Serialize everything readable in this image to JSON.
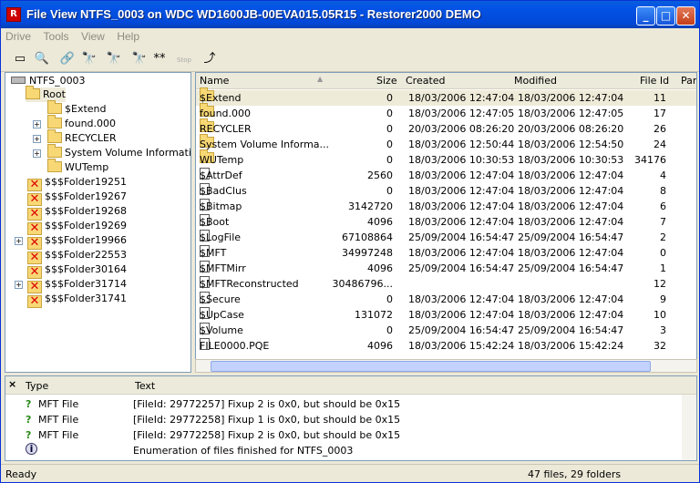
{
  "window": {
    "title": "File View NTFS_0003 on WDC WD1600JB-00EVA015.05R15 - Restorer2000 DEMO"
  },
  "menu": [
    "Drive",
    "Tools",
    "View",
    "Help"
  ],
  "toolbar": {
    "stop_label": "Stop"
  },
  "tree": {
    "root_drive": "NTFS_0003",
    "root": "Root",
    "root_children": [
      "$Extend",
      "found.000",
      "RECYCLER",
      "System Volume Information",
      "WUTemp"
    ],
    "lost_folders": [
      "$$$Folder19251",
      "$$$Folder19267",
      "$$$Folder19268",
      "$$$Folder19269",
      "$$$Folder19966",
      "$$$Folder22553",
      "$$$Folder30164",
      "$$$Folder31714",
      "$$$Folder31741"
    ]
  },
  "list": {
    "columns": [
      "Name",
      "Size",
      "Created",
      "Modified",
      "File Id",
      "Par"
    ],
    "rows": [
      {
        "name": "$Extend",
        "size": "0",
        "created": "18/03/2006 12:47:04",
        "modified": "18/03/2006 12:47:04",
        "id": "11",
        "kind": "folder"
      },
      {
        "name": "found.000",
        "size": "0",
        "created": "18/03/2006 12:47:05",
        "modified": "18/03/2006 12:47:05",
        "id": "17",
        "kind": "folder"
      },
      {
        "name": "RECYCLER",
        "size": "0",
        "created": "20/03/2006 08:26:20",
        "modified": "20/03/2006 08:26:20",
        "id": "26",
        "kind": "folder"
      },
      {
        "name": "System Volume Informa...",
        "size": "0",
        "created": "18/03/2006 12:50:44",
        "modified": "18/03/2006 12:54:50",
        "id": "24",
        "kind": "folder"
      },
      {
        "name": "WUTemp",
        "size": "0",
        "created": "18/03/2006 10:30:53",
        "modified": "18/03/2006 10:30:53",
        "id": "34176",
        "kind": "folder"
      },
      {
        "name": "$AttrDef",
        "size": "2560",
        "created": "18/03/2006 12:47:04",
        "modified": "18/03/2006 12:47:04",
        "id": "4",
        "kind": "file"
      },
      {
        "name": "$BadClus",
        "size": "0",
        "created": "18/03/2006 12:47:04",
        "modified": "18/03/2006 12:47:04",
        "id": "8",
        "kind": "file"
      },
      {
        "name": "$Bitmap",
        "size": "3142720",
        "created": "18/03/2006 12:47:04",
        "modified": "18/03/2006 12:47:04",
        "id": "6",
        "kind": "file"
      },
      {
        "name": "$Boot",
        "size": "4096",
        "created": "18/03/2006 12:47:04",
        "modified": "18/03/2006 12:47:04",
        "id": "7",
        "kind": "file"
      },
      {
        "name": "$LogFile",
        "size": "67108864",
        "created": "25/09/2004 16:54:47",
        "modified": "25/09/2004 16:54:47",
        "id": "2",
        "kind": "file"
      },
      {
        "name": "$MFT",
        "size": "34997248",
        "created": "18/03/2006 12:47:04",
        "modified": "18/03/2006 12:47:04",
        "id": "0",
        "kind": "file"
      },
      {
        "name": "$MFTMirr",
        "size": "4096",
        "created": "25/09/2004 16:54:47",
        "modified": "25/09/2004 16:54:47",
        "id": "1",
        "kind": "file"
      },
      {
        "name": "$MFTReconstructed",
        "size": "30486796...",
        "created": "",
        "modified": "",
        "id": "12",
        "kind": "file"
      },
      {
        "name": "$Secure",
        "size": "0",
        "created": "18/03/2006 12:47:04",
        "modified": "18/03/2006 12:47:04",
        "id": "9",
        "kind": "file"
      },
      {
        "name": "$UpCase",
        "size": "131072",
        "created": "18/03/2006 12:47:04",
        "modified": "18/03/2006 12:47:04",
        "id": "10",
        "kind": "file"
      },
      {
        "name": "$Volume",
        "size": "0",
        "created": "25/09/2004 16:54:47",
        "modified": "25/09/2004 16:54:47",
        "id": "3",
        "kind": "file"
      },
      {
        "name": "FILE0000.PQE",
        "size": "4096",
        "created": "18/03/2006 15:42:24",
        "modified": "18/03/2006 15:42:24",
        "id": "32",
        "kind": "file"
      }
    ]
  },
  "log": {
    "columns": [
      "Type",
      "Text"
    ],
    "rows": [
      {
        "type": "MFT File",
        "text": "[FileId: 29772257] Fixup 2 is 0x0, but should be 0x15",
        "icon": "question-icon"
      },
      {
        "type": "MFT File",
        "text": "[FileId: 29772258] Fixup 1 is 0x0, but should be 0x15",
        "icon": "question-icon"
      },
      {
        "type": "MFT File",
        "text": "[FileId: 29772258] Fixup 2 is 0x0, but should be 0x15",
        "icon": "question-icon"
      },
      {
        "type": "",
        "text": "Enumeration of files finished for NTFS_0003",
        "icon": "info-icon"
      }
    ]
  },
  "status": {
    "left": "Ready",
    "right": "47 files, 29 folders"
  }
}
